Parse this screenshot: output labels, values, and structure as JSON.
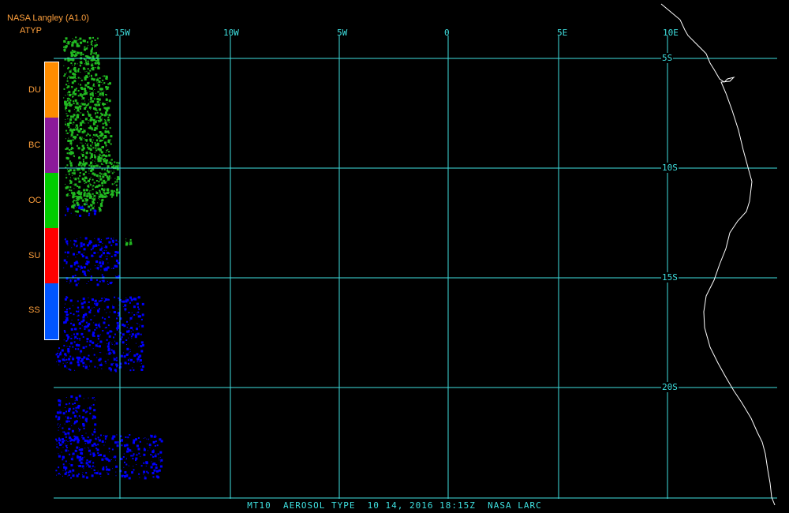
{
  "header": {
    "source": "NASA Langley (A1.0)",
    "product": "ATYP"
  },
  "legend": [
    {
      "label": "DU",
      "color": "#ff8c00"
    },
    {
      "label": "BC",
      "color": "#8b1a9a"
    },
    {
      "label": "OC",
      "color": "#00cc00"
    },
    {
      "label": "SU",
      "color": "#ff0000"
    },
    {
      "label": "SS",
      "color": "#0055ff"
    }
  ],
  "grid": {
    "lon_labels": [
      "15W",
      "10W",
      "5W",
      "0",
      "5E",
      "10E"
    ],
    "lat_labels": [
      "5S",
      "10S",
      "15S",
      "20S"
    ],
    "color": "#3fe0e0"
  },
  "footer": "MT10  AEROSOL TYPE  10 14, 2016 18:15Z  NASA LARC",
  "colors": {
    "background": "#000000",
    "coastline": "#ffffff",
    "dust": "#ff8c00",
    "black_carbon": "#8b1a9a",
    "organic_carbon": "#22bb22",
    "sulfate": "#ff0000",
    "sea_salt": "#0000ff"
  }
}
